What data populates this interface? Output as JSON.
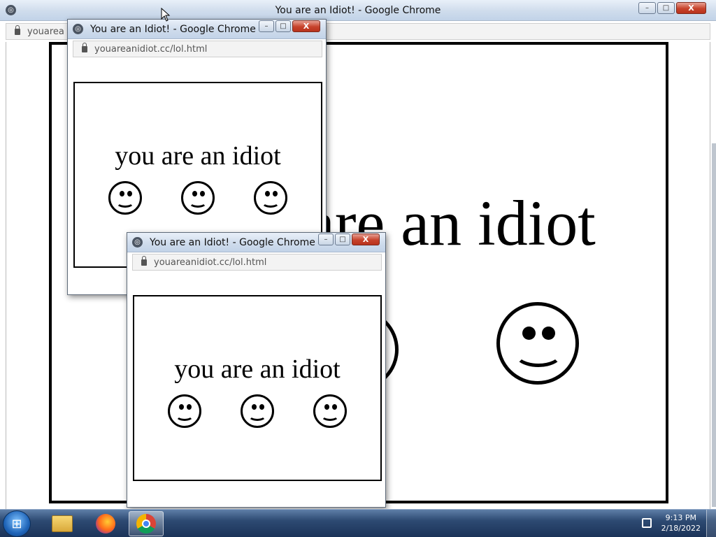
{
  "taskbar": {
    "start_icon": "windows-logo",
    "apps": [
      {
        "name": "file-explorer-icon",
        "symbol": "📁"
      },
      {
        "name": "firefox-icon",
        "symbol": "●"
      },
      {
        "name": "chrome-icon",
        "symbol": "◉"
      }
    ],
    "time": "9:13 PM",
    "date": "2/18/2022"
  },
  "main_window": {
    "title": "You are an Idiot! - Google Chrome",
    "url_partial": "youarea",
    "page_text": "you are an idiot"
  },
  "popup1": {
    "title": "You are an Idiot! - Google Chrome",
    "url": "youareanidiot.cc/lol.html",
    "page_text": "you are an idiot"
  },
  "popup2": {
    "title": "You are an Idiot! - Google Chrome",
    "url": "youareanidiot.cc/lol.html",
    "page_text": "you are an idiot"
  },
  "window_buttons": {
    "minimize": "–",
    "maximize": "□",
    "close": "X"
  },
  "colors": {
    "close_button": "#c7432c",
    "taskbar": "#2d4a72"
  }
}
